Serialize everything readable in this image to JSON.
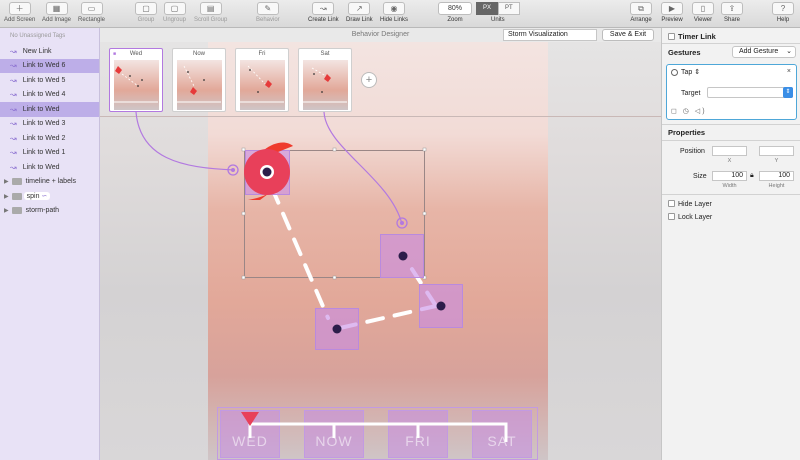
{
  "toolbar": {
    "add_screen": "Add Screen",
    "add_image": "Add Image",
    "rectangle": "Rectangle",
    "group": "Group",
    "ungroup": "Ungroup",
    "scroll_group": "Scroll Group",
    "behavior": "Behavior",
    "create_link": "Create Link",
    "draw_link": "Draw Link",
    "hide_links": "Hide Links",
    "zoom_value": "80%",
    "zoom_label": "Zoom",
    "units_px": "PX",
    "units_pt": "PT",
    "units_label": "Units",
    "arrange": "Arrange",
    "preview": "Preview",
    "viewer": "Viewer",
    "share": "Share",
    "help": "Help"
  },
  "sidebar": {
    "header": "No Unassigned Tags",
    "links": [
      {
        "label": "New Link",
        "selected": false
      },
      {
        "label": "Link to Wed 6",
        "selected": true
      },
      {
        "label": "Link to Wed 5",
        "selected": false
      },
      {
        "label": "Link to Wed 4",
        "selected": false
      },
      {
        "label": "Link to Wed",
        "selected": true
      },
      {
        "label": "Link to Wed 3",
        "selected": false
      },
      {
        "label": "Link to Wed 2",
        "selected": false
      },
      {
        "label": "Link to Wed 1",
        "selected": false
      },
      {
        "label": "Link to Wed",
        "selected": false
      }
    ],
    "groups": [
      {
        "label": "timeline + labels"
      },
      {
        "label": "spin"
      },
      {
        "label": "storm-path"
      }
    ]
  },
  "canvas": {
    "title": "Behavior Designer",
    "project_name": "Storm Visualization",
    "save_exit": "Save & Exit",
    "states": [
      {
        "label": "Wed",
        "active": true
      },
      {
        "label": "Now",
        "active": false
      },
      {
        "label": "Fri",
        "active": false
      },
      {
        "label": "Sat",
        "active": false
      }
    ],
    "timeline_labels": [
      "WED",
      "NOW",
      "FRI",
      "SAT"
    ]
  },
  "inspector": {
    "timer_link": "Timer Link",
    "gestures_title": "Gestures",
    "add_gesture": "Add Gesture",
    "gesture_type": "Tap",
    "target_label": "Target",
    "target_value": "",
    "properties_title": "Properties",
    "position_label": "Position",
    "x_value": "",
    "y_value": "",
    "x_sub": "X",
    "y_sub": "Y",
    "size_label": "Size",
    "width_value": "100",
    "height_value": "100",
    "width_sub": "Width",
    "height_sub": "Height",
    "hide_layer": "Hide Layer",
    "lock_layer": "Lock Layer"
  },
  "colors": {
    "accent_purple": "#b279e0",
    "selection": "#bdaee8",
    "storm_red": "#e8405a",
    "focus_blue": "#4ea7d8"
  }
}
